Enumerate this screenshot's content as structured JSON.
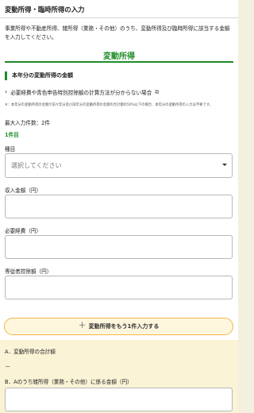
{
  "page": {
    "title": "変動所得・臨時所得の入力",
    "intro": "事業所得や不動産所得、雑所得（業務・その他）のうち、変動所得及び臨時所得に該当する金額を入力してください。"
  },
  "section": {
    "heading": "変動所得",
    "subheading": "本年分の変動所得の金額",
    "help_link": "必要経費や青色申告特別控除額の計算方法が分からない場合",
    "note": "※：本年分の変動所得の金額が前々年分及び前年分の変動所得の金額の合計額の50%以下の場合、本年分の変動所得の入力は不要です。",
    "max_count": "最大入力件数：2件",
    "item_count": "1件目"
  },
  "form": {
    "category_label": "種目",
    "category_placeholder": "選択してください",
    "income_label": "収入金額（円）",
    "expense_label": "必要経費（円）",
    "deduction_label": "専従者控除額（円）"
  },
  "actions": {
    "add_label": "変動所得をもう1件入力する"
  },
  "summary": {
    "a_label": "A．変動所得の合計額",
    "a_value": "－",
    "b_label": "B．Aのうち雑所得（業務・その他）に係る金額（円）"
  },
  "colors": {
    "accent_green": "#1f8c2a",
    "add_button_border": "#f2b84b",
    "summary_bg": "#fbf3d6"
  },
  "icons": {
    "help_link_chevron": "chevron-right-icon",
    "help_link_external": "external-link-icon",
    "select_caret": "caret-down-icon",
    "add_plus": "plus-icon"
  }
}
